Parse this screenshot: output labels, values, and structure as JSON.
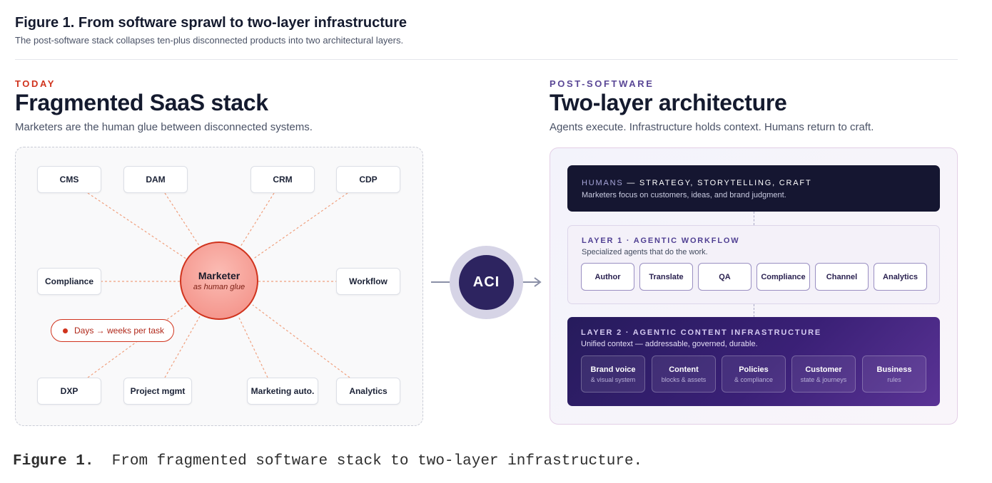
{
  "figure": {
    "title": "Figure 1. From software sprawl to two-layer infrastructure",
    "subtitle": "The post-software stack collapses ten-plus disconnected products into two architectural layers."
  },
  "left": {
    "eyebrow": "TODAY",
    "heading": "Fragmented SaaS stack",
    "lead": "Marketers are the human glue between disconnected systems.",
    "center_title": "Marketer",
    "center_subtitle": "as human glue",
    "tools": [
      "CMS",
      "DAM",
      "CRM",
      "CDP",
      "Compliance",
      "Workflow",
      "DXP",
      "Project mgmt",
      "Marketing auto.",
      "Analytics"
    ],
    "pain_label": "Days → weeks per task"
  },
  "bridge": {
    "label": "ACI"
  },
  "right": {
    "eyebrow": "POST-SOFTWARE",
    "heading": "Two-layer architecture",
    "lead": "Agents execute. Infrastructure holds context. Humans return to craft.",
    "humans": {
      "key": "HUMANS",
      "title": " — STRATEGY, STORYTELLING, CRAFT",
      "desc": "Marketers focus on customers, ideas, and brand judgment."
    },
    "layer1": {
      "title": "LAYER 1 · AGENTIC WORKFLOW",
      "desc": "Specialized agents that do the work.",
      "agents": [
        "Author",
        "Translate",
        "QA",
        "Compliance",
        "Channel",
        "Analytics"
      ]
    },
    "layer2": {
      "title": "LAYER 2 · AGENTIC CONTENT INFRASTRUCTURE",
      "desc": "Unified context — addressable, governed, durable.",
      "items": [
        {
          "name": "Brand voice",
          "sub": "& visual system"
        },
        {
          "name": "Content",
          "sub": "blocks & assets"
        },
        {
          "name": "Policies",
          "sub": "& compliance"
        },
        {
          "name": "Customer",
          "sub": "state & journeys"
        },
        {
          "name": "Business",
          "sub": "rules"
        }
      ]
    }
  },
  "caption": {
    "label": "Figure 1.",
    "text": "From fragmented software stack to two-layer infrastructure."
  },
  "colors": {
    "accent_red": "#d0331d",
    "accent_purple": "#5a4796",
    "dark_navy": "#151631",
    "infra_purple": "#3a2076"
  }
}
